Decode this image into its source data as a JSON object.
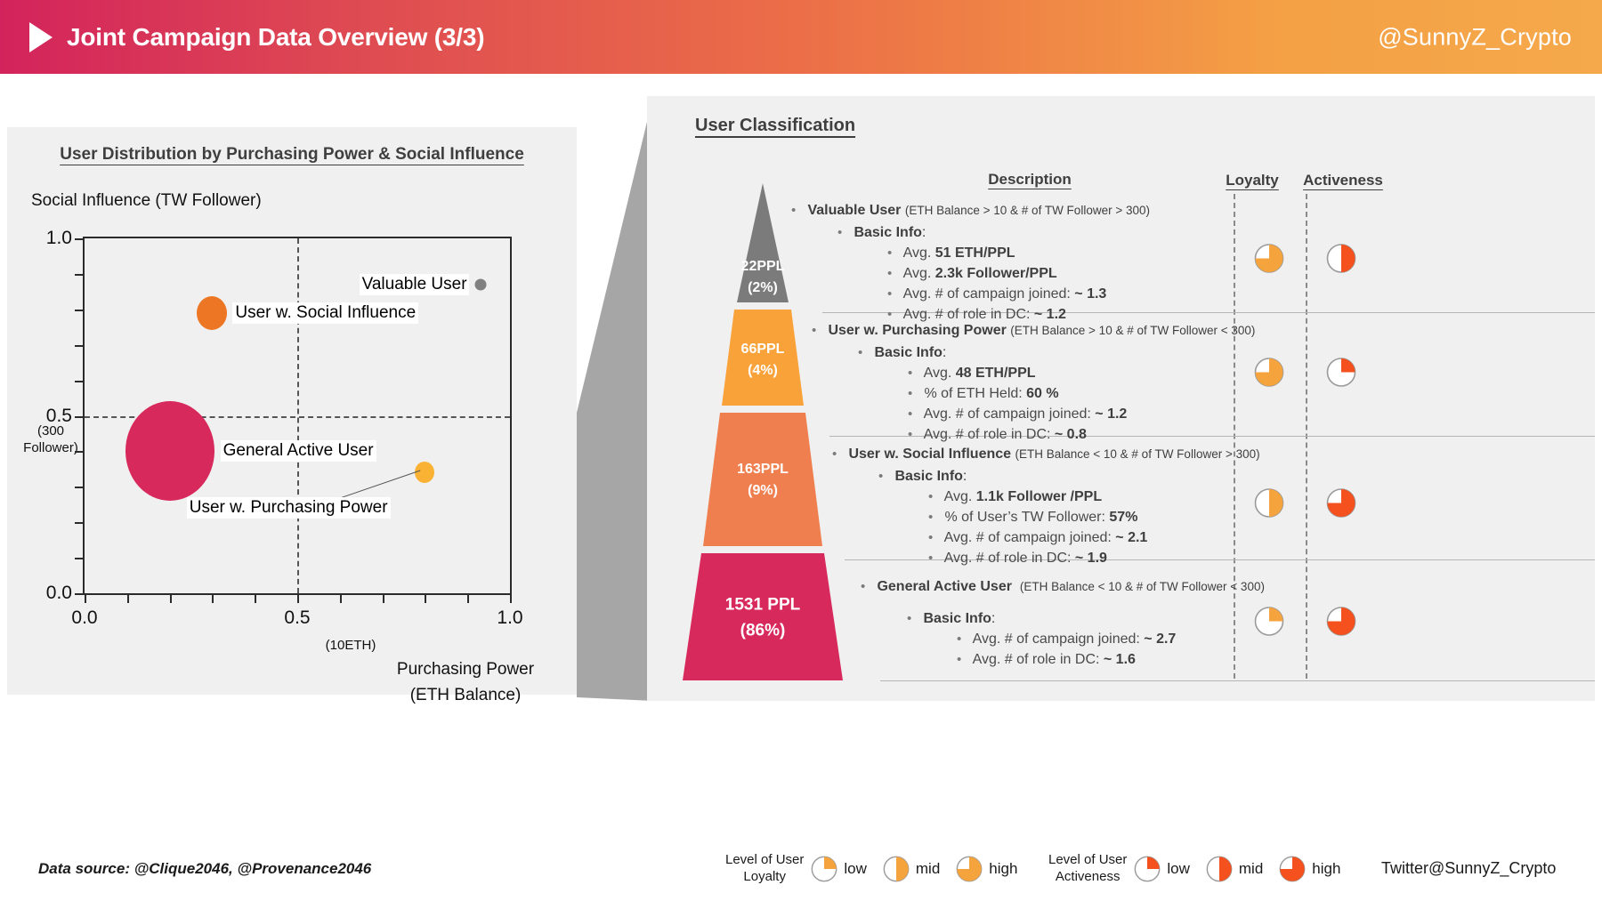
{
  "header": {
    "title": "Joint Campaign Data Overview (3/3)",
    "handle": "@SunnyZ_Crypto",
    "play_icon": "play-triangle-icon"
  },
  "chart_data": {
    "type": "scatter",
    "title": "User Distribution by Purchasing Power & Social Influence",
    "xlabel": "Purchasing Power",
    "xlabel_sub": "(ETH Balance)",
    "ylabel": "Social Influence  (TW Follower)",
    "xlim": [
      0.0,
      1.0
    ],
    "ylim": [
      0.0,
      1.0
    ],
    "xticks": [
      "0.0",
      "0.5",
      "1.0"
    ],
    "yticks": [
      "0.0",
      "0.5",
      "1.0"
    ],
    "x_mid_sub": "(10ETH)",
    "y_mid_sub": "(300\nFollower)",
    "y_mid_sub_line1": "(300",
    "y_mid_sub_line2": "Follower)",
    "grid": "dashed-crosshair-at-0.5",
    "points": [
      {
        "label": "Valuable User",
        "x": 0.93,
        "y": 0.87,
        "size": 13,
        "color": "#808080",
        "label_side": "left"
      },
      {
        "label": "User w. Social Influence",
        "x": 0.3,
        "y": 0.79,
        "size": 34,
        "color": "#ec7624",
        "label_side": "right"
      },
      {
        "label": "General Active User",
        "x": 0.2,
        "y": 0.4,
        "size": 100,
        "color": "#d8295c",
        "label_side": "right"
      },
      {
        "label": "User w. Purchasing Power",
        "x": 0.8,
        "y": 0.34,
        "size": 22,
        "color": "#f9b233",
        "label_side": "leader"
      }
    ]
  },
  "classification": {
    "title": "User Classification",
    "columns": {
      "description": "Description",
      "loyalty": "Loyalty",
      "activeness": "Activeness"
    },
    "pyramid": [
      {
        "count": "22PPL",
        "percent": "(2%)",
        "color": "#7b7b7b"
      },
      {
        "count": "66PPL",
        "percent": "(4%)",
        "color": "#f9a23a"
      },
      {
        "count": "163PPL",
        "percent": "(9%)",
        "color": "#ef7f4f"
      },
      {
        "count": "1531 PPL",
        "percent": "(86%)",
        "color": "#d8295c"
      }
    ],
    "segments": [
      {
        "name": "Valuable User",
        "condition": "(ETH Balance > 10 & # of TW Follower > 300)",
        "basic_info_label": "Basic Info",
        "facts": [
          {
            "text": "Avg. ",
            "value": "51 ETH/PPL"
          },
          {
            "text": "Avg. ",
            "value": "2.3k Follower/PPL"
          },
          {
            "text": "Avg. # of campaign joined: ",
            "value": "~ 1.3"
          },
          {
            "text": "Avg. # of role in DC: ",
            "value": "~ 1.2"
          }
        ],
        "loyalty": "high",
        "activeness": "mid"
      },
      {
        "name": "User w. Purchasing Power",
        "condition": "(ETH Balance > 10 & # of TW Follower < 300)",
        "basic_info_label": "Basic Info",
        "facts": [
          {
            "text": "Avg. ",
            "value": "48 ETH/PPL"
          },
          {
            "text": "% of ETH Held: ",
            "value": "60 %"
          },
          {
            "text": "Avg. # of campaign joined: ",
            "value": "~ 1.2"
          },
          {
            "text": "Avg. # of role in DC: ",
            "value": "~ 0.8"
          }
        ],
        "loyalty": "high",
        "activeness": "low"
      },
      {
        "name": "User w. Social Influence",
        "condition": "(ETH Balance < 10 & # of TW Follower > 300)",
        "basic_info_label": "Basic Info",
        "facts": [
          {
            "text": "Avg. ",
            "value": "1.1k Follower /PPL"
          },
          {
            "text": "% of User’s TW Follower: ",
            "value": "57%"
          },
          {
            "text": "Avg. # of campaign joined: ",
            "value": "~ 2.1"
          },
          {
            "text": "Avg. # of role in DC: ",
            "value": "~ 1.9"
          }
        ],
        "loyalty": "mid",
        "activeness": "high"
      },
      {
        "name": "General Active User",
        "condition": "(ETH Balance < 10 & # of TW Follower < 300)",
        "basic_info_label": "Basic Info",
        "facts": [
          {
            "text": "Avg. # of campaign joined: ",
            "value": "~ 2.7"
          },
          {
            "text": "Avg. # of role in DC: ",
            "value": "~ 1.6"
          }
        ],
        "loyalty": "low",
        "activeness": "high"
      }
    ]
  },
  "footer": {
    "data_source": "Data source: @Clique2046, @Provenance2046",
    "twitter": "Twitter@SunnyZ_Crypto",
    "loyalty_legend": {
      "title_line1": "Level of User",
      "title_line2": "Loyalty",
      "levels": [
        "low",
        "mid",
        "high"
      ],
      "color": "#f5a33c"
    },
    "activeness_legend": {
      "title_line1": "Level of User",
      "title_line2": "Activeness",
      "levels": [
        "low",
        "mid",
        "high"
      ],
      "color": "#f4511e"
    }
  },
  "colors": {
    "brand_pink": "#d3235c",
    "brand_orange": "#f5a94a",
    "panel_bg": "#f0f0f0",
    "loyalty": "#f5a33c",
    "activeness": "#f4511e",
    "wedge_gray": "#a6a6a6"
  }
}
